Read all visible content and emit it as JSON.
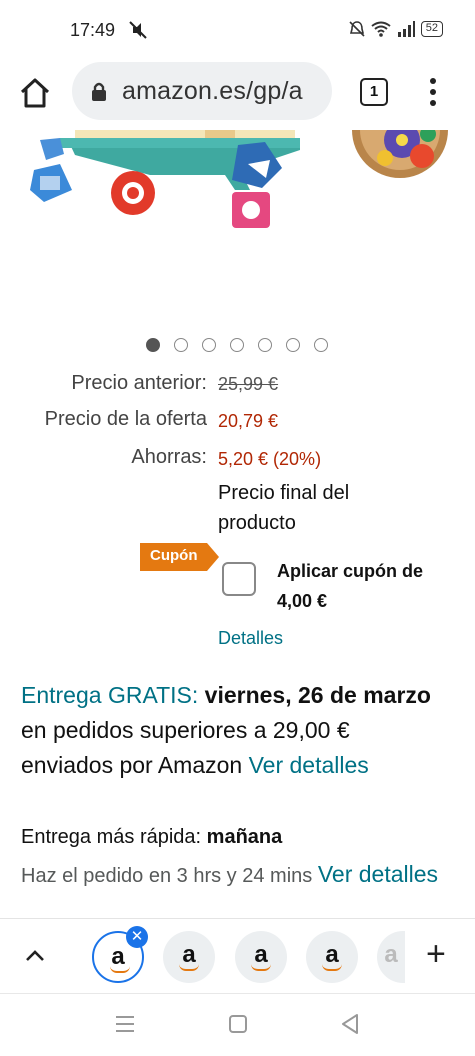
{
  "status": {
    "time": "17:49",
    "battery": "52"
  },
  "browser": {
    "url": "amazon.es/gp/a",
    "tab_count": "1"
  },
  "gallery": {
    "dot_count": 7,
    "active_index": 0
  },
  "price": {
    "old_label": "Precio anterior:",
    "old_value": "25,99 €",
    "offer_label": "Precio de la oferta",
    "offer_value": "20,79 €",
    "savings_label": "Ahorras:",
    "savings_value": "5,20 € (20%)",
    "final_line1": "Precio final del",
    "final_line2": "producto"
  },
  "coupon": {
    "badge": "Cupón",
    "text": "Aplicar cupón de 4,00 €",
    "details": "Detalles",
    "checked": false
  },
  "delivery": {
    "free_label": "Entrega GRATIS:",
    "date": "viernes, 26 de marzo",
    "condition": "en pedidos superiores a 29,00 € enviados por Amazon",
    "link": "Ver detalles"
  },
  "fast_delivery": {
    "label": "Entrega más rápida:",
    "when": "mañana",
    "order_text": "Haz el pedido en 3 hrs y 24 mins",
    "link": "Ver detalles"
  },
  "tab_strip": {
    "tab_letter": "a"
  },
  "colors": {
    "accent": "#007185",
    "price_red": "#b12704",
    "coupon_orange": "#e47911",
    "chrome_blue": "#1a73e8"
  }
}
